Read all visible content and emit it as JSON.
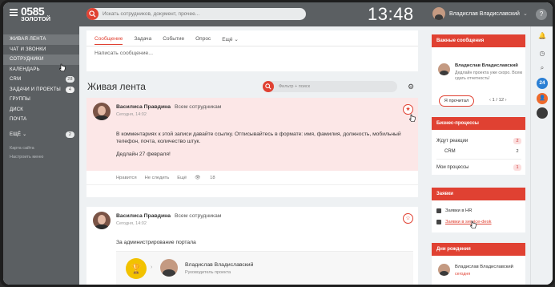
{
  "header": {
    "logo_number": "0585",
    "logo_sub": "ЗОЛОТОЙ",
    "search_placeholder": "Искать сотрудников, документ, прочее...",
    "clock": "13:48",
    "user_name": "Владислав Владиславский",
    "help": "?"
  },
  "sidebar": {
    "items": [
      {
        "label": "ЖИВАЯ ЛЕНТА",
        "badge": ""
      },
      {
        "label": "ЧАТ И ЗВОНКИ",
        "badge": ""
      },
      {
        "label": "СОТРУДНИКИ",
        "badge": ""
      },
      {
        "label": "КАЛЕНДАРЬ",
        "badge": ""
      },
      {
        "label": "CRM",
        "badge": "28"
      },
      {
        "label": "ЗАДАЧИ И ПРОЕКТЫ",
        "badge": "4"
      },
      {
        "label": "ГРУППЫ",
        "badge": ""
      },
      {
        "label": "ДИСК",
        "badge": ""
      },
      {
        "label": "ПОЧТА",
        "badge": ""
      },
      {
        "label": "ЕЩЁ",
        "badge": "2"
      }
    ],
    "links": [
      "Карта сайта",
      "Настроить меню"
    ]
  },
  "composer": {
    "tabs": [
      "Сообщение",
      "Задача",
      "Событие",
      "Опрос",
      "Ещё"
    ],
    "placeholder": "Написать сообщение..."
  },
  "feed": {
    "title": "Живая лента",
    "filter_placeholder": "Фильтр + поиск"
  },
  "posts": [
    {
      "author": "Василиса Правдина",
      "arrow": ">",
      "target": "Всем сотрудникам",
      "date": "Сегодня, 14:02",
      "text1": "В комментариях к этой записи давайте ссылку. Отписывайтесь в формате: имя, фамилия, должность, мобильный",
      "text2": "телефон, почта, количество штук.",
      "text3": "Дедлайн 27 февраля!",
      "actions": [
        "Нравится",
        "Не следить",
        "Ещё"
      ],
      "views": "18"
    },
    {
      "author": "Василиса Правдина",
      "arrow": ">",
      "target": "Всем сотрудникам",
      "date": "Сегодня, 14:02",
      "text1": "За администрирование портала",
      "nested_name": "Владислав Владиславский",
      "nested_role": "Руководитель проекта"
    }
  ],
  "widgets": {
    "important": {
      "title": "Важные сообщения",
      "name": "Владислав Владиславский",
      "text": "Дедлайн проекта уже скоро. Всем сдать отчетность!",
      "button": "Я прочитал",
      "pager": "‹ 1 / 12 ›"
    },
    "processes": {
      "title": "Бизнес-процессы",
      "rows": [
        {
          "label": "Ждут реакции",
          "count": "2"
        },
        {
          "label": "CRM",
          "count": "2"
        },
        {
          "label": "Мои процессы",
          "count": "1"
        }
      ]
    },
    "requests": {
      "title": "Заявки",
      "rows": [
        "Заявки в HR",
        "Заявки в service-desk"
      ]
    },
    "birthdays": {
      "title": "Дни рождения",
      "name": "Владислав Владиславский",
      "date": "сегодня"
    }
  },
  "rail": {
    "counter": "24"
  }
}
